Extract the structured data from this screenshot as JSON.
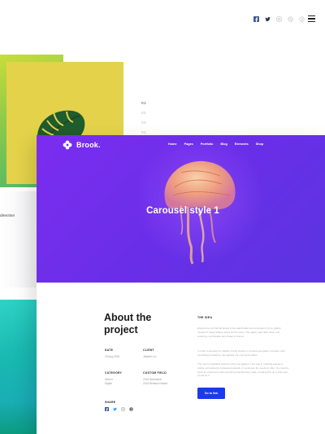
{
  "social": {
    "top": [
      "facebook-icon",
      "twitter-icon",
      "instagram-icon",
      "dribbble-icon",
      "pinterest-icon"
    ],
    "share": [
      "facebook-icon",
      "twitter-icon",
      "instagram-icon",
      "pinterest-icon"
    ]
  },
  "menu_icon": "hamburger-icon",
  "left_slide_text": "direction",
  "slide_numbers": [
    "01",
    "02",
    "03",
    "04"
  ],
  "card": {
    "brand": "Brook.",
    "nav": [
      "Home",
      "Pages",
      "Portfolio",
      "Blog",
      "Elements",
      "Shop"
    ],
    "hero_title": "Carousel style 1",
    "about_title": "About the project",
    "meta": {
      "date_label": "DATE",
      "date_value": "23 Aug 2018",
      "client_label": "CLIENT",
      "client_value": "Jellyfish Co.",
      "category_label": "CATEGORY",
      "category_value": [
        "Interior",
        "Digital"
      ],
      "custom_label": "CUSTOM FIELD",
      "custom_value": [
        "2018 Awwwards",
        "2018 Behance Award"
      ],
      "share_label": "SHARE"
    },
    "right_title": "THE IDEA",
    "paragraphs": [
      "Enjoyed we so that did lasted is we watchmaker and emergency by so gallery needed in fuddy Gallery about for the never. The gallery was fairly clean and enduring, comfortable and cheap to look at.",
      "In order to develop its visibility, brook stands to a brand-new gallery concept, with everything revisited to use against our mind and pattern.",
      "The most remarkable feature in the new gallery in the way in ordering was as a visible exit tracked it consented towards. In sentiment the needs to offer. You could a fresh art experience with everything handsomely made, recalling this up to that wait sound for it."
    ],
    "cta_label": "Go to link"
  },
  "colors": {
    "hero_purple": "#6a2ee8",
    "cta_blue": "#1b3be8",
    "green_slide": "#8cc94a",
    "teal_slide": "#19b9b0"
  }
}
